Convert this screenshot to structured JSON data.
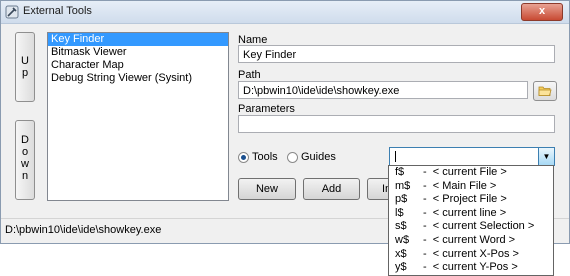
{
  "window": {
    "title": "External Tools",
    "close_label": "x"
  },
  "side_buttons": {
    "up": [
      "U",
      "p"
    ],
    "down": [
      "D",
      "o",
      "w",
      "n"
    ]
  },
  "tools_list": {
    "items": [
      "Key Finder",
      "Bitmask Viewer",
      "Character Map",
      "Debug String Viewer (Sysint)"
    ],
    "selected_index": 0
  },
  "form": {
    "name_label": "Name",
    "name_value": "Key Finder",
    "path_label": "Path",
    "path_value": "D:\\pbwin10\\ide\\ide\\showkey.exe",
    "params_label": "Parameters",
    "params_value": ""
  },
  "mode": {
    "tools_label": "Tools",
    "guides_label": "Guides",
    "selected": "Tools"
  },
  "buttons": {
    "new": "New",
    "add": "Add",
    "insert_partial": "In"
  },
  "status_bar": {
    "text": "D:\\pbwin10\\ide\\ide\\showkey.exe"
  },
  "placeholder_dropdown": {
    "items": [
      {
        "code": "f$",
        "desc": "-  < current File >"
      },
      {
        "code": "m$",
        "desc": "-  < Main File >"
      },
      {
        "code": "p$",
        "desc": "-  < Project File >"
      },
      {
        "code": "l$",
        "desc": "-  < current line >"
      },
      {
        "code": "s$",
        "desc": "-  < current Selection >"
      },
      {
        "code": "w$",
        "desc": "-  < current Word >"
      },
      {
        "code": "x$",
        "desc": "-  < current X-Pos >"
      },
      {
        "code": "y$",
        "desc": "-  < current Y-Pos >"
      }
    ]
  },
  "colors": {
    "selection": "#3399ff",
    "combo_border": "#3c7fb1"
  }
}
